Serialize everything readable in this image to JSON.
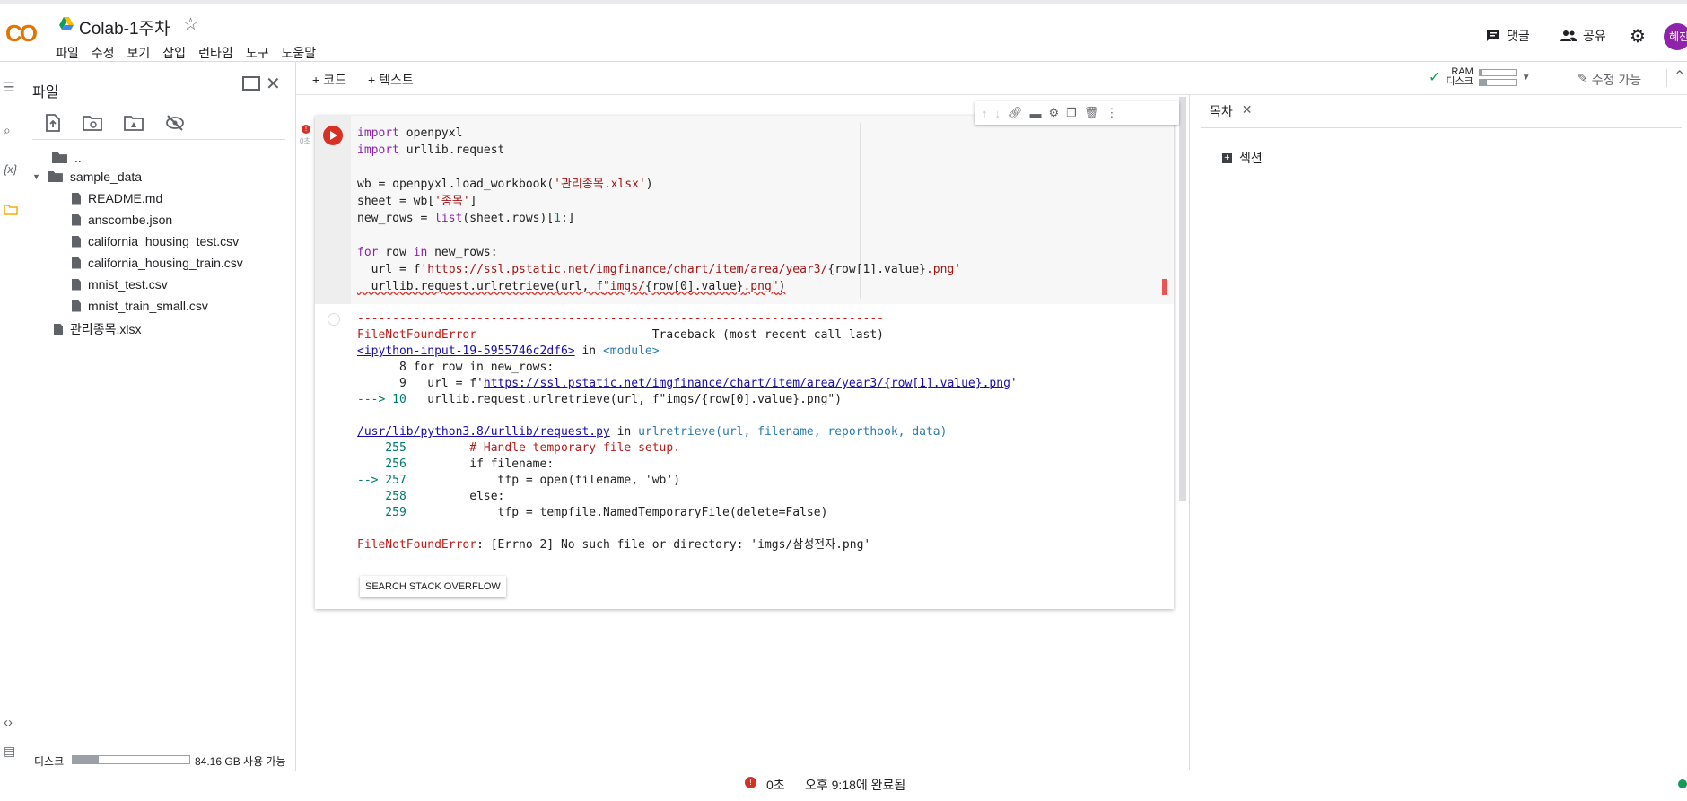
{
  "header": {
    "logo": "CO",
    "title": "Colab-1주차",
    "menu": [
      "파일",
      "수정",
      "보기",
      "삽입",
      "런타임",
      "도구",
      "도움말"
    ],
    "comment_label": "댓글",
    "share_label": "공유",
    "avatar_text": "혜진"
  },
  "files": {
    "title": "파일",
    "items": [
      {
        "name": "..",
        "type": "up"
      },
      {
        "name": "sample_data",
        "type": "folder"
      },
      {
        "name": "README.md",
        "type": "file"
      },
      {
        "name": "anscombe.json",
        "type": "file"
      },
      {
        "name": "california_housing_test.csv",
        "type": "file"
      },
      {
        "name": "california_housing_train.csv",
        "type": "file"
      },
      {
        "name": "mnist_test.csv",
        "type": "file"
      },
      {
        "name": "mnist_train_small.csv",
        "type": "file"
      },
      {
        "name": "관리종목.xlsx",
        "type": "file"
      }
    ],
    "disk_label": "디스크",
    "disk_available": "84.16 GB 사용 가능",
    "disk_used_fraction": 0.22
  },
  "toolbar": {
    "add_code": "+ 코드",
    "add_text": "+ 텍스트",
    "ram_label": "RAM",
    "disk_label": "디스크",
    "edit_label": "수정 가능"
  },
  "cell": {
    "exec_label": "0초",
    "code": {
      "l1_kw": "import",
      "l1_rest": " openpyxl",
      "l2_kw": "import",
      "l2_rest": " urllib.request",
      "l4_a": "wb = openpyxl.load_workbook(",
      "l4_str": "'관리종목.xlsx'",
      "l4_b": ")",
      "l5_a": "sheet = wb[",
      "l5_str": "'종목'",
      "l5_b": "]",
      "l6_a": "new_rows = ",
      "l6_kw": "list",
      "l6_b": "(sheet.rows)[",
      "l6_num": "1",
      "l6_c": ":]",
      "l8_kw": "for",
      "l8_a": " row ",
      "l8_kw2": "in",
      "l8_b": " new_rows:",
      "l9_a": "  url = f'",
      "l9_link": "https://ssl.pstatic.net/imgfinance/chart/item/area/year3/",
      "l9_b": "{row[1].value}",
      "l9_c": ".png'",
      "l10_a": "  urllib.request.urlretrieve(url, f",
      "l10_str": "\"imgs/",
      "l10_b": "{row[0].value}",
      "l10_c": ".png\"",
      "l10_d": ")"
    },
    "output": {
      "dashes": "---------------------------------------------------------------------------",
      "err_name": "FileNotFoundError",
      "tb_header": "                         Traceback (most recent call last)",
      "input_link": "<ipython-input-19-5955746c2df6>",
      "in_word": " in ",
      "module": "<module>",
      "t8": "      8 for row in new_rows:",
      "t9_a": "      9   url = f'",
      "t9_link": "https://ssl.pstatic.net/imgfinance/chart/item/area/year3/{row[1].value}.png",
      "t9_b": "'",
      "t10_arrow": "---> 10",
      "t10_rest": "   urllib.request.urlretrieve(url, f\"imgs/{row[0].value}.png\")",
      "lib_link": "/usr/lib/python3.8/urllib/request.py",
      "lib_in": " in ",
      "lib_fn": "urlretrieve",
      "lib_args": "(url, filename, reporthook, data)",
      "n255": "    255",
      "c255": "         # Handle temporary file setup.",
      "n256": "    256",
      "c256": "         if filename:",
      "n257_arrow": "--> 257",
      "c257": "             tfp = open(filename, 'wb')",
      "n258": "    258",
      "c258": "         else:",
      "n259": "    259",
      "c259": "             tfp = tempfile.NamedTemporaryFile(delete=False)",
      "final_err": "FileNotFoundError",
      "final_msg": ": [Errno 2] No such file or directory: 'imgs/삼성전자.png'",
      "so_button": "SEARCH STACK OVERFLOW"
    }
  },
  "toc": {
    "title": "목차",
    "section_label": "섹션"
  },
  "status": {
    "duration": "0초",
    "completed": "오후 9:18에 완료됨"
  }
}
